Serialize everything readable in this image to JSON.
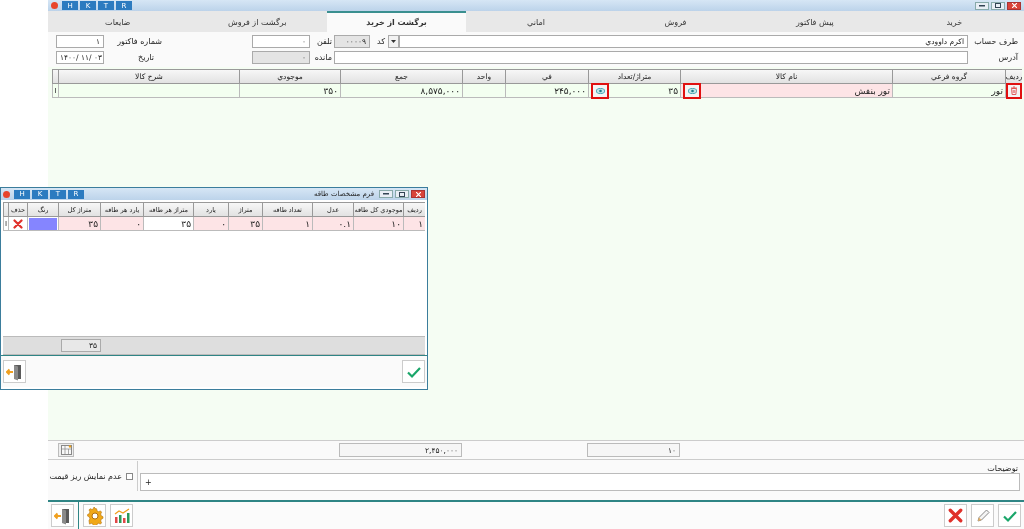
{
  "window": {
    "toolbar_buttons": [
      "R",
      "T",
      "K",
      "H"
    ]
  },
  "tabs": [
    {
      "label": "خريد",
      "selected": false
    },
    {
      "label": "پيش فاکتور",
      "selected": false
    },
    {
      "label": "فروش",
      "selected": false
    },
    {
      "label": "اماني",
      "selected": false
    },
    {
      "label": "برگشت از خريد",
      "selected": true
    },
    {
      "label": "برگشت از فروش",
      "selected": false
    },
    {
      "label": "ضايعات",
      "selected": false
    }
  ],
  "form": {
    "account": {
      "label": "طرف حساب",
      "value": "اکرم داوودي"
    },
    "code": {
      "label": "کد",
      "value": "۰۰۰۰۹"
    },
    "phone": {
      "label": "تلفن",
      "value": "۰"
    },
    "invoice_number": {
      "label": "شماره فاکتور",
      "value": "۱"
    },
    "address": {
      "label": "آدرس"
    },
    "balance": {
      "label": "مانده",
      "value": "۰"
    },
    "date": {
      "label": "تاريخ",
      "value": "۱۴۰۰/ ۱۱/ ۰۳"
    }
  },
  "items_table": {
    "columns": [
      {
        "label": "رديف"
      },
      {
        "label": "گروه فرعي"
      },
      {
        "label": "نام کالا"
      },
      {
        "label": "متراژ/تعداد",
        "total": "۱۰"
      },
      {
        "label": "في"
      },
      {
        "label": "واحد"
      },
      {
        "label": "جمع",
        "total": "۲,۴۵۰,۰۰۰"
      },
      {
        "label": "موجودي"
      },
      {
        "label": "شرح کالا"
      }
    ],
    "rows": [
      {
        "marker": "I",
        "cells": [
          {
            "kind": "delete",
            "highlighted": true
          },
          {
            "kind": "text",
            "text": "تور"
          },
          {
            "kind": "lookup",
            "text": "تور بنفش",
            "shaded": true,
            "highlighted": true
          },
          {
            "kind": "lookup",
            "text": "۳۵",
            "shaded": false,
            "highlighted": true
          },
          {
            "kind": "text",
            "text": "۲۴۵,۰۰۰"
          },
          {
            "kind": "empty"
          },
          {
            "kind": "text",
            "text": "۸,۵۷۵,۰۰۰"
          },
          {
            "kind": "text",
            "text": "۳۵۰"
          },
          {
            "kind": "empty"
          }
        ]
      }
    ]
  },
  "notes": {
    "label": "توضيحات",
    "add_symbol": "+",
    "checkbox": {
      "label": "عدم نمايش ريز قيمت",
      "checked": false
    }
  },
  "dialog": {
    "title": "فرم مشخصات طاقه",
    "toolbar_buttons": [
      "R",
      "T",
      "K",
      "H"
    ],
    "columns": [
      "رديف",
      "موجودي کل طاقه",
      "عدل",
      "تعداد طاقه",
      "متراژ",
      "يارد",
      "متراژ هر طاقه",
      "يارد هر طاقه",
      "متراژ کل",
      "رنگ",
      "حذف"
    ],
    "rows": [
      {
        "marker": "I",
        "cells": [
          {
            "kind": "text",
            "text": "۱",
            "shaded": true
          },
          {
            "kind": "text",
            "text": "۱۰",
            "shaded": true
          },
          {
            "kind": "text",
            "text": "۰.۱",
            "shaded": true
          },
          {
            "kind": "text",
            "text": "۱",
            "shaded": true
          },
          {
            "kind": "text",
            "text": "۳۵",
            "shaded": true
          },
          {
            "kind": "text",
            "text": "۰",
            "shaded": true
          },
          {
            "kind": "text",
            "text": "۳۵",
            "shaded": false
          },
          {
            "kind": "text",
            "text": "۰",
            "shaded": true
          },
          {
            "kind": "text",
            "text": "۳۵",
            "shaded": true
          },
          {
            "kind": "color",
            "color": "#8585ff"
          },
          {
            "kind": "delete"
          }
        ]
      }
    ],
    "total": "۳۵"
  }
}
